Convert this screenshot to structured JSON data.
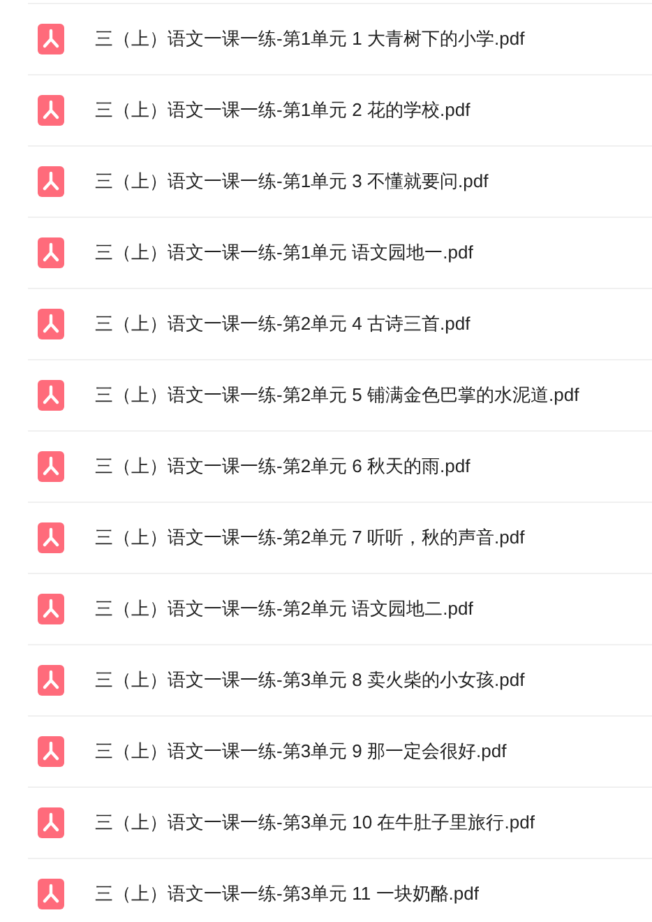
{
  "files": [
    {
      "name": "三（上）语文一课一练-第1单元 1 大青树下的小学.pdf"
    },
    {
      "name": "三（上）语文一课一练-第1单元 2 花的学校.pdf"
    },
    {
      "name": "三（上）语文一课一练-第1单元 3 不懂就要问.pdf"
    },
    {
      "name": "三（上）语文一课一练-第1单元 语文园地一.pdf"
    },
    {
      "name": "三（上）语文一课一练-第2单元 4 古诗三首.pdf"
    },
    {
      "name": "三（上）语文一课一练-第2单元 5 铺满金色巴掌的水泥道.pdf"
    },
    {
      "name": "三（上）语文一课一练-第2单元 6 秋天的雨.pdf"
    },
    {
      "name": "三（上）语文一课一练-第2单元 7 听听，秋的声音.pdf"
    },
    {
      "name": "三（上）语文一课一练-第2单元 语文园地二.pdf"
    },
    {
      "name": "三（上）语文一课一练-第3单元 8 卖火柴的小女孩.pdf"
    },
    {
      "name": "三（上）语文一课一练-第3单元 9 那一定会很好.pdf"
    },
    {
      "name": "三（上）语文一课一练-第3单元 10 在牛肚子里旅行.pdf"
    },
    {
      "name": "三（上）语文一课一练-第3单元 11 一块奶酪.pdf"
    }
  ]
}
